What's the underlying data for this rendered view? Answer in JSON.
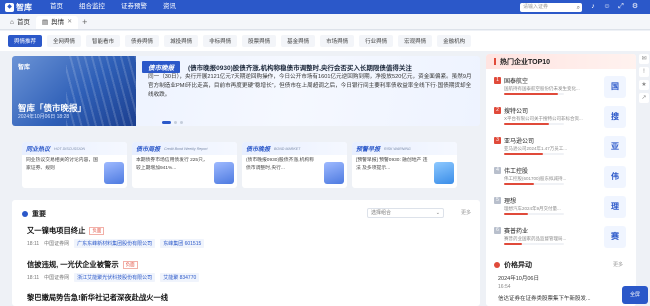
{
  "topbar": {
    "logo": "智库",
    "nav": [
      "首页",
      "组合监控",
      "证券预警",
      "资讯"
    ],
    "search_placeholder": "请输入证券",
    "icons": [
      "search-icon",
      "bell-icon",
      "user-icon",
      "expand-icon",
      "gear-icon"
    ]
  },
  "tabs": [
    {
      "label": "首页"
    },
    {
      "label": "舆情",
      "active": true
    }
  ],
  "filters": [
    "舆情推荐",
    "全网舆情",
    "智能看市",
    "债券舆情",
    "城投舆情",
    "非标舆情",
    "股票舆情",
    "基金舆情",
    "市场舆情",
    "行业舆情",
    "宏观舆情",
    "金融机构"
  ],
  "banner": {
    "image_logo": "智库",
    "image_title": "智库「债市晚报」",
    "image_date": "2024年10月06日 18:28",
    "tag": "债市晚报",
    "headline": "(债市晚报0930)股债齐涨,机构称稳债市调整时,央行会否买入长期限债值得关注",
    "body": "同一（30日），央行开展2121亿元7天期逆回购操作，今日公开市场有1601亿元逆回购到期，净投放520亿元，资金面偏紧。虽然9月官方制造业PMI环比走高，目前市再度更硬“稳增长”，但债市在上周超调之后，今日银行间主要利率债收益率全线下行·国债期货却全线收跌。",
    "slides": 3,
    "active_slide": 1
  },
  "cards": [
    {
      "cn": "同业热议",
      "en": "HOT DISCUSSION",
      "desc": "同业热议交易相关的讨论内容，国家证券、规则"
    },
    {
      "cn": "债市周报",
      "en": "Credit Bond Weekly Report",
      "desc": "本期债券市场信用债发行 225只，较上期增加941%..."
    },
    {
      "cn": "债市晚报",
      "en": "BOND MARKET",
      "desc": "(债市晚报0930)股债齐涨,机构称债市调整时,央行..."
    },
    {
      "cn": "预警早报",
      "en": "RISK WARNING",
      "desc": "[预警早报] 预警0930: 融创地产 违法 及多项提示..."
    }
  ],
  "news": {
    "title": "重要",
    "select_placeholder": "选择组合",
    "more": "更多",
    "items": [
      {
        "title": "又一镍电项目终止",
        "tag": "负面",
        "time": "18:11",
        "source": "中国证券网",
        "chips": [
          "广东东峰新材料集团股份有限公司",
          "东峰集团 601515"
        ]
      },
      {
        "title": "信披违规, 一光伏企业被警示",
        "tag": "负面",
        "time": "18:11",
        "source": "中国证券网",
        "chips": [
          "浙江艾能聚光伏科技股份有限公司",
          "艾能聚 834770"
        ]
      },
      {
        "title": "黎巴嫩局势告急!新华社记者深夜赴战火一线",
        "tag": "",
        "time": "",
        "source": "",
        "chips": []
      }
    ]
  },
  "hot": {
    "title": "热门企业TOP10",
    "items": [
      {
        "rank": 1,
        "name": "国泰航空",
        "desc": "国航持有国泰航空股份仍未发生变化...",
        "heat": 0.9,
        "badge": "国"
      },
      {
        "rank": 2,
        "name": "搜特公司",
        "desc": "X平台有限公司关于搜特公司非标合资...",
        "heat": 0.75,
        "badge": "搜"
      },
      {
        "rank": 3,
        "name": "亚马逊公司",
        "desc": "亚马逊公司2024年1.47万员工...",
        "heat": 0.65,
        "badge": "亚"
      },
      {
        "rank": 4,
        "name": "伟工控股",
        "desc": "伟工控股(601700)股东拟减持...",
        "heat": 0.5,
        "badge": "伟"
      },
      {
        "rank": 5,
        "name": "理想",
        "desc": "理想汽车2024年9月交付量...",
        "heat": 0.4,
        "badge": "理"
      },
      {
        "rank": 6,
        "name": "赛普药业",
        "desc": "赛普药业国家药品监督管理局...",
        "heat": 0.3,
        "badge": "赛"
      }
    ]
  },
  "price": {
    "title": "价格异动",
    "more": "更多",
    "date": "2024年10月06日",
    "time": "16:54",
    "text": "信达证券在证券类股票集下午新股发..."
  },
  "float_buttons": [
    "chat-icon",
    "alert-icon",
    "bookmark-icon",
    "share-icon"
  ],
  "fullscreen_label": "全屏"
}
